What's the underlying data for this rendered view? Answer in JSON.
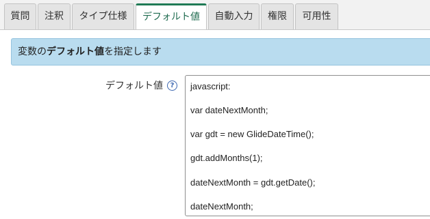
{
  "tabs": [
    {
      "label": "質問"
    },
    {
      "label": "注釈"
    },
    {
      "label": "タイプ仕様"
    },
    {
      "label": "デフォルト値"
    },
    {
      "label": "自動入力"
    },
    {
      "label": "権限"
    },
    {
      "label": "可用性"
    }
  ],
  "active_tab": "デフォルト値",
  "info": {
    "prefix": "変数の",
    "bold": "デフォルト値",
    "suffix": "を指定します"
  },
  "field": {
    "label": "デフォルト値",
    "help_icon": "question-circle-icon",
    "code_lines": [
      "javascript:",
      "var dateNextMonth;",
      "var gdt = new GlideDateTime();",
      "gdt.addMonths(1);",
      "dateNextMonth = gdt.getDate();",
      "dateNextMonth;"
    ]
  },
  "colors": {
    "accent": "#1f7a55",
    "info_background": "#b9dcef",
    "help_icon": "#3b66b0"
  }
}
